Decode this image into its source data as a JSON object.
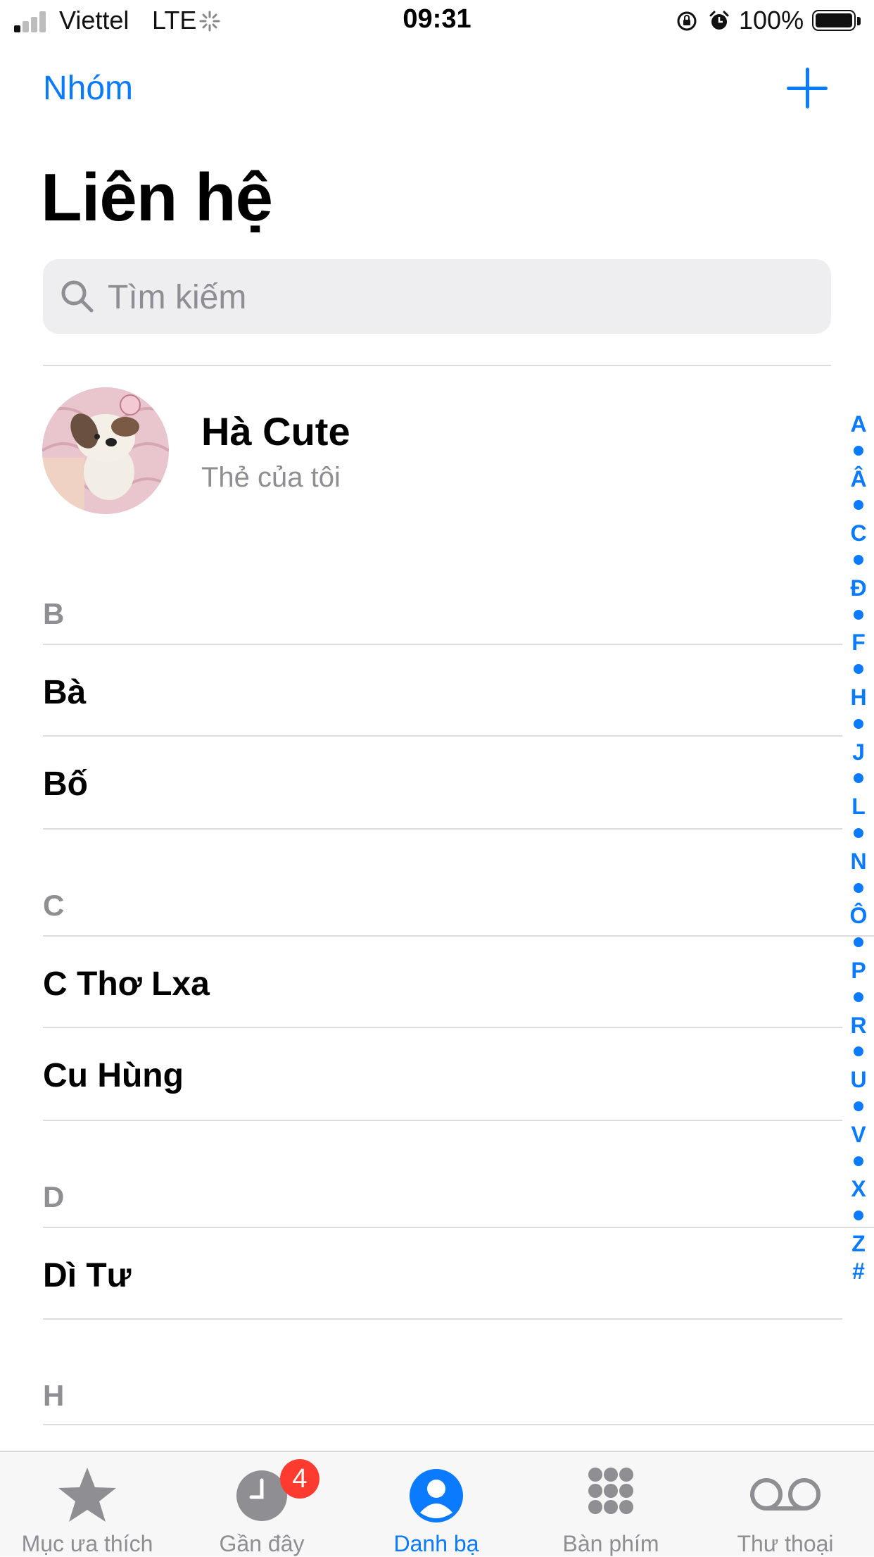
{
  "status_bar": {
    "carrier": "Viettel",
    "network": "LTE",
    "time": "09:31",
    "battery": "100%"
  },
  "nav": {
    "groups_label": "Nhóm",
    "add_icon": "plus-icon"
  },
  "title": "Liên hệ",
  "search": {
    "placeholder": "Tìm kiếm"
  },
  "my_card": {
    "name": "Hà Cute",
    "subtitle": "Thẻ của tôi"
  },
  "sections": [
    {
      "letter": "B",
      "contacts": [
        "Bà",
        "Bố"
      ]
    },
    {
      "letter": "C",
      "contacts": [
        "C Thơ Lxa",
        "Cu Hùng"
      ]
    },
    {
      "letter": "D",
      "contacts": [
        "Dì Tư"
      ]
    },
    {
      "letter": "H",
      "contacts": []
    }
  ],
  "index": [
    "A",
    "•",
    "Â",
    "•",
    "C",
    "•",
    "Đ",
    "•",
    "F",
    "•",
    "H",
    "•",
    "J",
    "•",
    "L",
    "•",
    "N",
    "•",
    "Ô",
    "•",
    "P",
    "•",
    "R",
    "•",
    "U",
    "•",
    "V",
    "•",
    "X",
    "•",
    "Z",
    "#"
  ],
  "tabs": [
    {
      "label": "Mục ưa thích",
      "icon": "star-icon"
    },
    {
      "label": "Gần đây",
      "icon": "clock-icon",
      "badge": "4"
    },
    {
      "label": "Danh bạ",
      "icon": "person-circle-icon"
    },
    {
      "label": "Bàn phím",
      "icon": "keypad-icon"
    },
    {
      "label": "Thư thoại",
      "icon": "voicemail-icon"
    }
  ],
  "colors": {
    "accent": "#0a7aff",
    "badge": "#ff3b30",
    "secondary": "#8e8e93"
  }
}
